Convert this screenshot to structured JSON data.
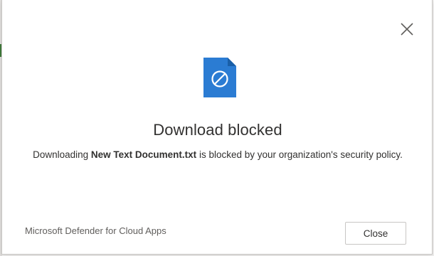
{
  "dialog": {
    "title": "Download blocked",
    "message": {
      "prefix": "Downloading ",
      "filename": "New Text Document.txt",
      "suffix": " is blocked by your organization's security policy."
    },
    "brand": "Microsoft Defender for Cloud Apps",
    "close_button_label": "Close",
    "close_x_label": "Close dialog",
    "icon": "blocked-file-icon"
  },
  "colors": {
    "file_icon": "#2b7cd3",
    "file_icon_fold": "#1a5fa8",
    "text": "#323130",
    "muted_text": "#605e5c",
    "border": "#c8c6c4"
  }
}
